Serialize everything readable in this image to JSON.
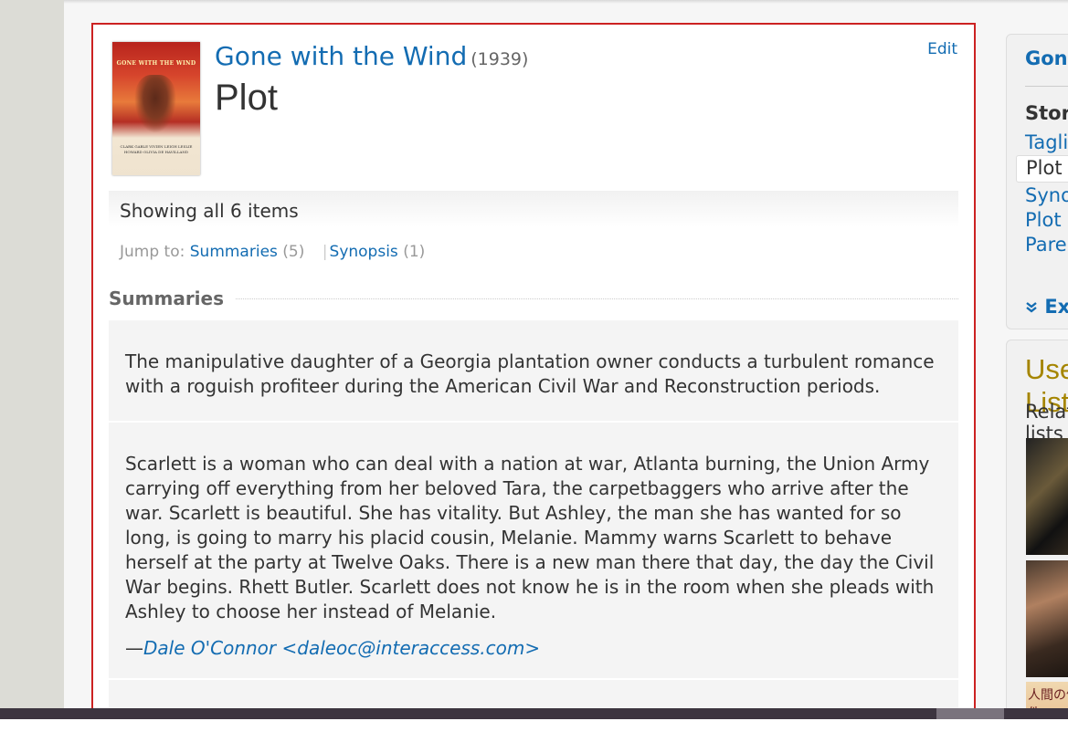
{
  "header": {
    "movie_title": "Gone with the Wind",
    "year": "(1939)",
    "page_heading": "Plot",
    "edit_label": "Edit"
  },
  "poster": {
    "title_text": "GONE WITH THE WIND",
    "credits_text": "CLARK GABLE VIVIEN LEIGH LESLIE HOWARD OLIVIA DE HAVILLAND"
  },
  "showing": "Showing all 6 items",
  "jump": {
    "label": "Jump to:",
    "items": [
      {
        "label": "Summaries",
        "count": "(5)"
      },
      {
        "label": "Synopsis",
        "count": "(1)"
      }
    ],
    "separator": "|"
  },
  "summaries": {
    "section_title": "Summaries",
    "items": [
      {
        "text": "The manipulative daughter of a Georgia plantation owner conducts a turbulent romance with a roguish profiteer during the American Civil War and Reconstruction periods."
      },
      {
        "text": "Scarlett is a woman who can deal with a nation at war, Atlanta burning, the Union Army carrying off everything from her beloved Tara, the carpetbaggers who arrive after the war. Scarlett is beautiful. She has vitality. But Ashley, the man she has wanted for so long, is going to marry his placid cousin, Melanie. Mammy warns Scarlett to behave herself at the party at Twelve Oaks. There is a new man there that day, the day the Civil War begins. Rhett Butler. Scarlett does not know he is in the room when she pleads with Ashley to choose her instead of Melanie.",
        "author_dash": "—",
        "author": "Dale O'Connor <daleoc@interaccess.com>"
      }
    ]
  },
  "sidebar": {
    "title": "Gone with the Wind",
    "section": "Storyline",
    "links": [
      "Taglines",
      "Synopsis",
      "Plot Keywords",
      "Parents Guide"
    ],
    "active": "Plot Summary",
    "explore_icon": "double-chevron-down-icon",
    "explore_label": "Explore More"
  },
  "sidebar2": {
    "title": "User Lists",
    "subtitle": "Related lists",
    "thumb3_text": "人間の條件"
  },
  "colors": {
    "link": "#136cb2",
    "highlight_border": "#cc2222",
    "list_title": "#a58500"
  }
}
